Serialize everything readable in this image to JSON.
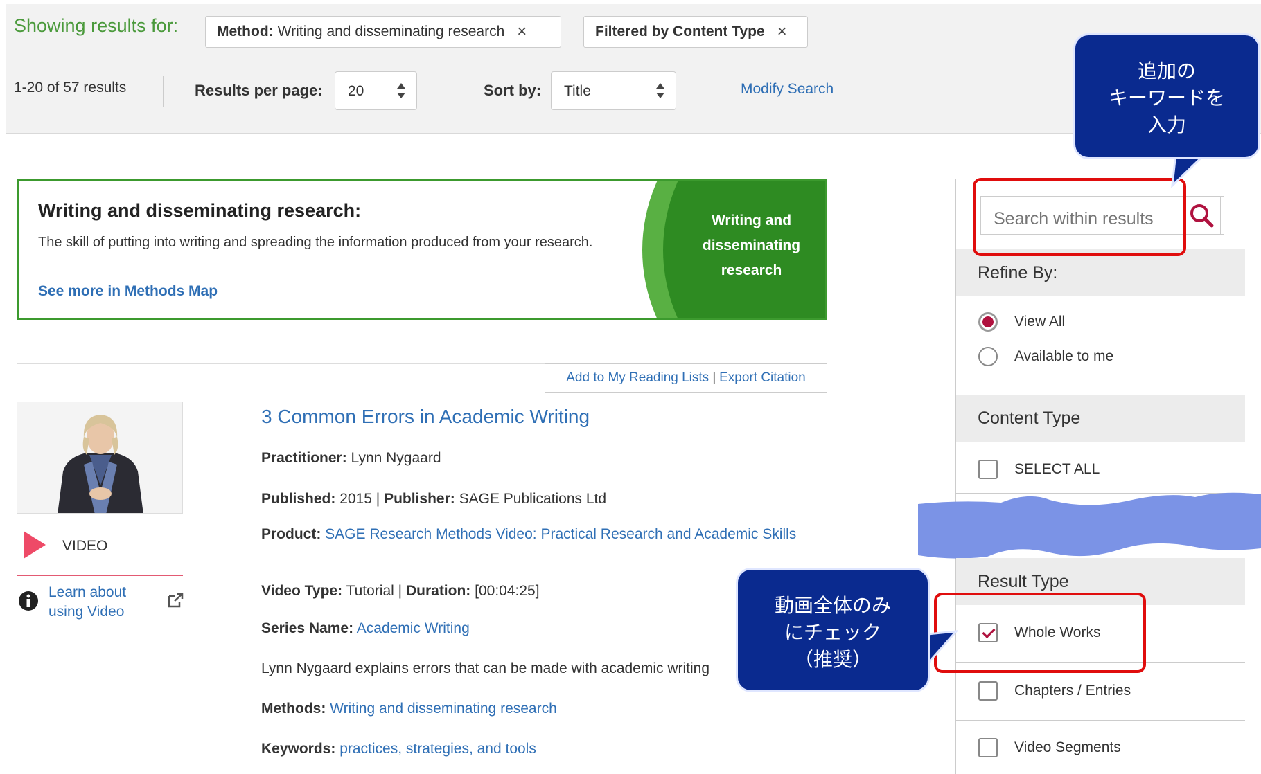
{
  "topbar": {
    "showing_label": "Showing results for:",
    "chip_method_key": "Method:",
    "chip_method_value": "Writing and disseminating research",
    "chip_content_type": "Filtered by Content Type",
    "chip_close": "×",
    "results_count": "1-20 of 57 results",
    "per_page_label": "Results per page:",
    "per_page_value": "20",
    "sort_label": "Sort by:",
    "sort_value": "Title",
    "modify_search": "Modify Search"
  },
  "callouts": {
    "keyword": [
      "追加の",
      "キーワードを",
      "入力"
    ],
    "whole_works": [
      "動画全体のみ",
      "にチェック",
      "（推奨）"
    ]
  },
  "definition": {
    "title": "Writing and disseminating research:",
    "description": "The skill of putting into writing and spreading the information produced from your research.",
    "link": "See more in Methods Map",
    "badge": [
      "Writing and",
      "disseminating",
      "research"
    ]
  },
  "result_actions": {
    "reading_lists": "Add to My Reading Lists",
    "separator": "|",
    "export": "Export Citation"
  },
  "result": {
    "title": "3 Common Errors in Academic Writing",
    "media_type": "VIDEO",
    "learn_about": "Learn about using Video",
    "practitioner_label": "Practitioner:",
    "practitioner": "Lynn Nygaard",
    "published_label": "Published:",
    "published": "2015",
    "publisher_label": "Publisher:",
    "publisher": "SAGE Publications Ltd",
    "product_label": "Product:",
    "product": "SAGE Research Methods Video: Practical Research and Academic Skills",
    "video_type_label": "Video Type:",
    "video_type": "Tutorial",
    "duration_label": "Duration:",
    "duration": "[00:04:25]",
    "series_label": "Series Name:",
    "series": "Academic Writing",
    "summary": "Lynn Nygaard explains errors that can be made with academic writing",
    "methods_label": "Methods:",
    "methods": "Writing and disseminating research",
    "keywords_label": "Keywords:",
    "keywords": "practices, strategies, and tools",
    "meta_sep": "|"
  },
  "sidebar": {
    "search_placeholder": "Search within results",
    "refine_by": "Refine By:",
    "view_all": "View All",
    "available": "Available to me",
    "content_type": "Content Type",
    "select_all": "SELECT ALL",
    "result_type": "Result Type",
    "whole_works": "Whole Works",
    "chapters": "Chapters / Entries",
    "video_segments": "Video Segments"
  },
  "colors": {
    "accent_green": "#3c9a2e",
    "link_blue": "#2f6fb5",
    "callout_navy": "#0a2a8f",
    "highlight_red": "#e00d0d",
    "redaction_blue": "#7b93e6"
  }
}
